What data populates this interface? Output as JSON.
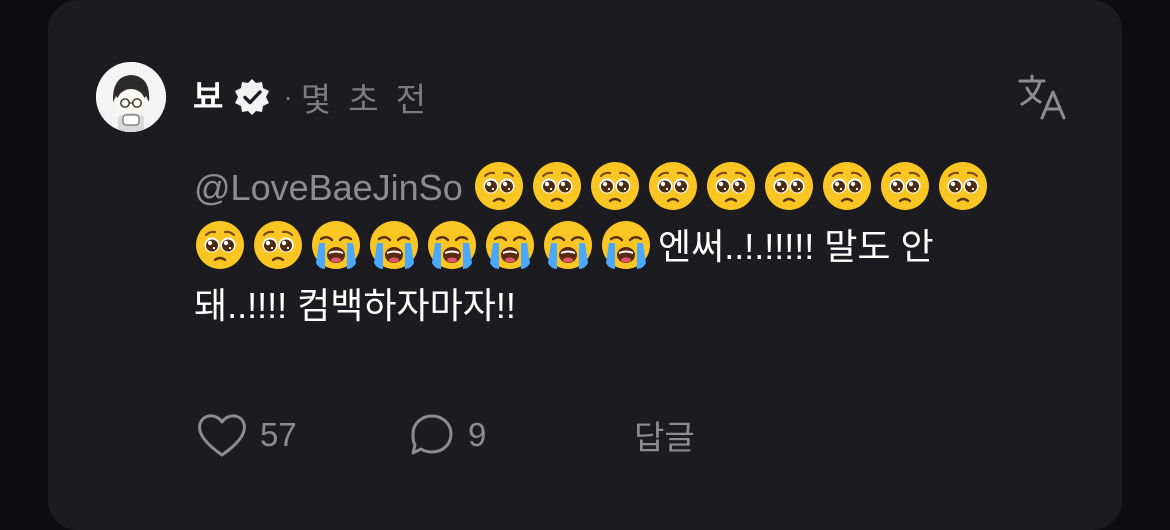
{
  "post": {
    "username": "뵤",
    "time": "몇 초 전",
    "separator": "·",
    "mention": "@LoveBaeJinSo",
    "text": "엔써..!.!!!!! 말도 안 돼..!!!! 컴백하자마자!!",
    "pleading_emoji_count": 11,
    "crying_emoji_count": 6
  },
  "actions": {
    "likes": "57",
    "comments": "9",
    "reply_label": "답글"
  },
  "icons": [
    "verified-badge-icon",
    "translate-icon",
    "heart-icon",
    "comment-icon",
    "pleading-face-emoji",
    "loudly-crying-face-emoji"
  ]
}
